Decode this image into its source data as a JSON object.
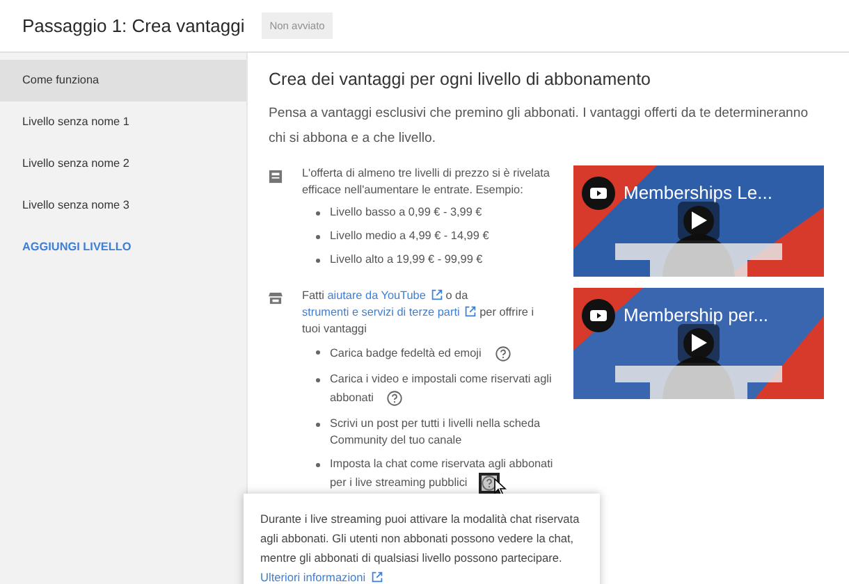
{
  "header": {
    "title": "Passaggio 1: Crea vantaggi",
    "status": "Non avviato"
  },
  "sidebar": {
    "items": [
      {
        "label": "Come funziona",
        "selected": true,
        "kind": "item"
      },
      {
        "label": "Livello senza nome 1",
        "selected": false,
        "kind": "item"
      },
      {
        "label": "Livello senza nome 2",
        "selected": false,
        "kind": "item"
      },
      {
        "label": "Livello senza nome 3",
        "selected": false,
        "kind": "item"
      },
      {
        "label": "AGGIUNGI LIVELLO",
        "selected": false,
        "kind": "action"
      }
    ]
  },
  "main": {
    "heading": "Crea dei vantaggi per ogni livello di abbonamento",
    "intro": "Pensa a vantaggi esclusivi che premino gli abbonati. I vantaggi offerti da te determineranno chi si abbona e a che livello.",
    "sections": [
      {
        "text": [
          {
            "kind": "plain",
            "text": "L'offerta di almeno tre livelli di prezzo si è rivelata efficace nell'aumentare le entrate. Esempio:"
          }
        ],
        "bullets": [
          {
            "text": "Livello basso a 0,99 € - 3,99 €"
          },
          {
            "text": "Livello medio a 4,99 € - 14,99 €"
          },
          {
            "text": "Livello alto a 19,99 € - 99,99 €"
          }
        ],
        "video": {
          "title": "Memberships Le..."
        }
      },
      {
        "text": [
          {
            "kind": "plain",
            "text": "Fatti "
          },
          {
            "kind": "link",
            "text": "aiutare da YouTube"
          },
          {
            "kind": "plain",
            "text": " o da "
          },
          {
            "kind": "link",
            "text": "strumenti e servizi di terze parti"
          },
          {
            "kind": "plain",
            "text": " per offrire i tuoi vantaggi"
          }
        ],
        "bullets": [
          {
            "text": "Carica badge fedeltà ed emoji",
            "help": true,
            "hovered": false
          },
          {
            "text": "Carica i video e impostali come riservati agli abbonati",
            "help": true,
            "hovered": false
          },
          {
            "text": "Scrivi un post per tutti i livelli nella scheda Community del tuo canale",
            "help": false
          },
          {
            "text": "Imposta la chat come riservata agli abbonati per i live streaming pubblici",
            "help": true,
            "hovered": true
          }
        ],
        "video": {
          "title": "Membership per..."
        }
      }
    ]
  },
  "tooltip": {
    "text": "Durante i live streaming puoi attivare la modalità chat riservata agli abbonati. Gli utenti non abbonati possono vedere la chat, mentre gli abbonati di qualsiasi livello possono partecipare.",
    "link": "Ulteriori informazioni"
  }
}
